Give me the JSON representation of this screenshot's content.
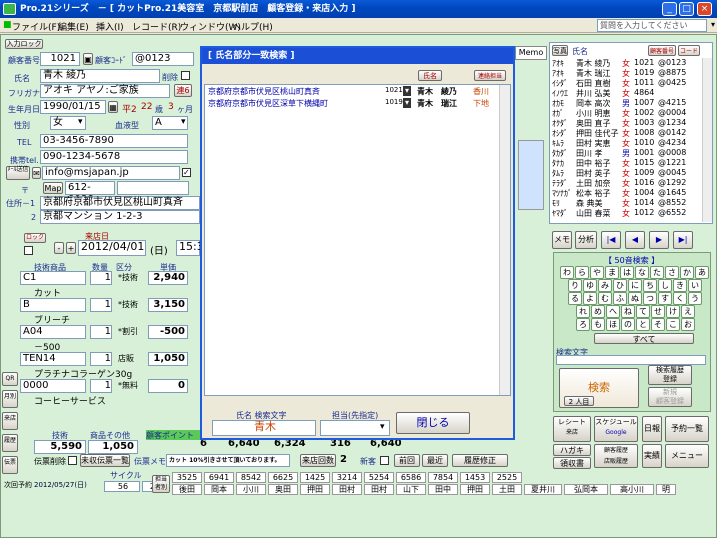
{
  "window": {
    "title": "Pro.21シリーズ　－ [ カットPro.21美容室　京都駅前店　顧客登録・来店入力 ]"
  },
  "menu": {
    "items": [
      "ファイル(F)",
      "編集(E)",
      "挿入(I)",
      "レコード(R)",
      "ウィンドウ(W)",
      "ヘルプ(H)"
    ],
    "help_placeholder": "質問を入力してください"
  },
  "customer": {
    "lock_label": "入力ロック",
    "no_label": "顧客番号",
    "no_value": "1021",
    "code_label": "顧客ｺｰﾄﾞ",
    "code_value": "@0123",
    "name_label": "氏名",
    "name_value": "青木 綾乃",
    "delete_label": "削除",
    "kana_label": "フリガナ",
    "kana_value": "アオキ アヤノ:ご家族",
    "link_label": "連6",
    "birth_label": "生年月日",
    "birth_value": "1990/01/15",
    "era": "平2",
    "age": "22",
    "age_unit": "歳",
    "month": "3",
    "month_unit": "ヶ月",
    "sex_label": "性別",
    "sex_value": "女",
    "blood_label": "血液型",
    "blood_value": "A",
    "tel_label": "TEL",
    "tel_value": "03-3456-7890",
    "mobile_label": "携帯tel.",
    "mobile_value": "090-1234-5678",
    "mail_btn": "ﾒｰﾙ送信",
    "mail_value": "info@msjapan.jp",
    "zip_label": "〒",
    "map_btn": "Map",
    "zip_value": "612-0086",
    "addr1_label": "住所－1",
    "addr1_value": "京都府京都市伏見区桃山町真斉",
    "addr2_label": "2",
    "addr2_value": "京都マンション 1-2-3"
  },
  "visit": {
    "lock_btn": "ロック",
    "date_label": "来店日",
    "date_value": "2012/04/01",
    "weekday": "(日)",
    "time_value": "15:3",
    "col_tech": "技術商品",
    "col_qty": "数量",
    "col_type": "区分",
    "col_price": "単価"
  },
  "lines": [
    {
      "code": "C1",
      "qty": "1",
      "type": "*技術",
      "price": "2,940",
      "name": "カット"
    },
    {
      "code": "B",
      "qty": "1",
      "type": "*技術",
      "price": "3,150",
      "name": "ブリーチ"
    },
    {
      "code": "A04",
      "qty": "1",
      "type": "*割引",
      "price": "-500",
      "name": "－500"
    },
    {
      "code": "TEN14",
      "qty": "1",
      "type": "店販",
      "price": "1,050",
      "name": "プラチナコラーゲン30g"
    },
    {
      "code": "0000",
      "qty": "1",
      "type": "*無料",
      "price": "0",
      "name": "コーヒーサービス"
    }
  ],
  "summary": {
    "tech_label": "技術",
    "goods_label": "商品その他",
    "point_label": "顧客ポイント",
    "tech_value": "5,590",
    "goods_value": "1,050",
    "n1": "6",
    "n2": "6,640",
    "n3": "6,324",
    "n4": "316",
    "n5": "6,640"
  },
  "bottom": {
    "delete_btn": "伝票削除",
    "unpaid_btn": "未収伝票一覧",
    "memo_label": "伝票メモ",
    "memo_text": "カット 10%引きさせて頂いております。",
    "visits_btn": "来店回数",
    "visits_value": "2",
    "new_label": "新客",
    "prev_btn": "前回",
    "latest_btn": "最近",
    "history_btn": "履歴修正",
    "next_label": "次回予約",
    "next_date": "2012/05/27(日)",
    "cycle_label": "サイクル",
    "cycle_a": "56",
    "cycle_b": "24",
    "staff_label": "担当者別"
  },
  "left_tabs": [
    "QR",
    "月別",
    "来店",
    "履歴",
    "伝票"
  ],
  "dialog": {
    "title": "[ 氏名部分一致検索 ]",
    "name_btn": "氏名",
    "contact_btn": "連絡担当",
    "results": [
      {
        "addr": "京都府京都市伏見区桃山町真斉",
        "no": "1021",
        "name": "青木　綾乃",
        "staff": "香川"
      },
      {
        "addr": "京都府京都市伏見区深草下横縄町",
        "no": "1019",
        "name": "青木　瑞江",
        "staff": "下地"
      }
    ],
    "search_label": "氏名 検索文字",
    "search_value": "青木",
    "staff_label": "担当(先指定)",
    "close_btn": "閉じる"
  },
  "customer_list": {
    "photo_label": "写真",
    "name_header": "氏名",
    "no_btn": "顧客番号",
    "code_btn": "コード",
    "rows": [
      {
        "k": "ｱｵｷ",
        "n": "青木 綾乃",
        "s": "女",
        "no": "1021",
        "c": "@0123"
      },
      {
        "k": "ｱｵｷ",
        "n": "青木 瑞江",
        "s": "女",
        "no": "1019",
        "c": "@8875"
      },
      {
        "k": "ｲｼﾀﾞ",
        "n": "石田 直樹",
        "s": "女",
        "no": "1011",
        "c": "@0425"
      },
      {
        "k": "ｲﾉｳｴ",
        "n": "井川 弘美",
        "s": "女",
        "no": "4864",
        "c": ""
      },
      {
        "k": "ｵｶﾓ",
        "n": "岡本 高次",
        "s": "男",
        "no": "1007",
        "c": "@4215"
      },
      {
        "k": "ｵｶﾞ",
        "n": "小川 明恵",
        "s": "女",
        "no": "1002",
        "c": "@0004"
      },
      {
        "k": "ｵｸﾀﾞ",
        "n": "奥田 直子",
        "s": "女",
        "no": "1003",
        "c": "@1234"
      },
      {
        "k": "ｵｼﾀﾞ",
        "n": "押田 佳代子",
        "s": "女",
        "no": "1008",
        "c": "@0142"
      },
      {
        "k": "ｷﾑﾗ",
        "n": "田村 実恵",
        "s": "女",
        "no": "1010",
        "c": "@4234"
      },
      {
        "k": "ﾀｶﾀﾞ",
        "n": "田川 孝",
        "s": "男",
        "no": "1001",
        "c": "@0008"
      },
      {
        "k": "ﾀﾅｶ",
        "n": "田中 裕子",
        "s": "女",
        "no": "1015",
        "c": "@1221"
      },
      {
        "k": "ﾀﾑﾗ",
        "n": "田村 英子",
        "s": "女",
        "no": "1009",
        "c": "@0045"
      },
      {
        "k": "ﾃﾗﾀﾞ",
        "n": "土田 加奈",
        "s": "女",
        "no": "1016",
        "c": "@1292"
      },
      {
        "k": "ﾏﾂﾅｶﾞ",
        "n": "松本 裕子",
        "s": "女",
        "no": "1004",
        "c": "@1645"
      },
      {
        "k": "ﾓﾘ",
        "n": "森 典美",
        "s": "女",
        "no": "1014",
        "c": "@8552"
      },
      {
        "k": "ﾔﾏﾀﾞ",
        "n": "山田 春菜",
        "s": "女",
        "no": "1012",
        "c": "@6552"
      }
    ]
  },
  "right_tools": {
    "memo": "メモ",
    "analysis": "分析",
    "first": "|◀",
    "prev": "◀",
    "next": "▶",
    "last": "▶|"
  },
  "kana_panel": {
    "title": "【 50音検索 】",
    "rows": [
      [
        "わ",
        "ら",
        "や",
        "ま",
        "は",
        "な",
        "た",
        "さ",
        "か",
        "あ"
      ],
      [
        "り",
        "ゆ",
        "み",
        "ひ",
        "に",
        "ち",
        "し",
        "き",
        "い"
      ],
      [
        "る",
        "よ",
        "む",
        "ふ",
        "ぬ",
        "つ",
        "す",
        "く",
        "う"
      ],
      [
        "れ",
        "め",
        "へ",
        "ね",
        "て",
        "せ",
        "け",
        "え"
      ],
      [
        "ろ",
        "も",
        "ほ",
        "の",
        "と",
        "そ",
        "こ",
        "お"
      ]
    ],
    "all_btn": "すべて",
    "search_text_label": "検索文字",
    "search_btn": "検索",
    "count": "2 人目",
    "history_btn": "検索履歴\n登録",
    "new_btn": "新規\n顧客登録"
  },
  "bottom_tools": {
    "receipt": "レシート",
    "schedule": "スケジュール",
    "daily": "日報",
    "reservations": "予約一覧",
    "print": "印刷",
    "postcard": "ハガキ",
    "cust_mgmt": "顧客履歴\n店販履歴",
    "results": "実績",
    "menu": "メニュー",
    "recv_btn": "来店",
    "google": "Google",
    "status": "領収書"
  },
  "strip": {
    "nums": [
      "3525",
      "6941",
      "8542",
      "6625",
      "1425",
      "3214",
      "5254",
      "6586",
      "7854",
      "1453",
      "2525"
    ],
    "names": [
      "後田",
      "岡本",
      "小川",
      "奥田",
      "押田",
      "田村",
      "田村",
      "山下",
      "田中",
      "押田",
      "土田",
      "夏井川",
      "弘岡本",
      "高小川",
      "明"
    ]
  },
  "memo_tab": "Memo"
}
